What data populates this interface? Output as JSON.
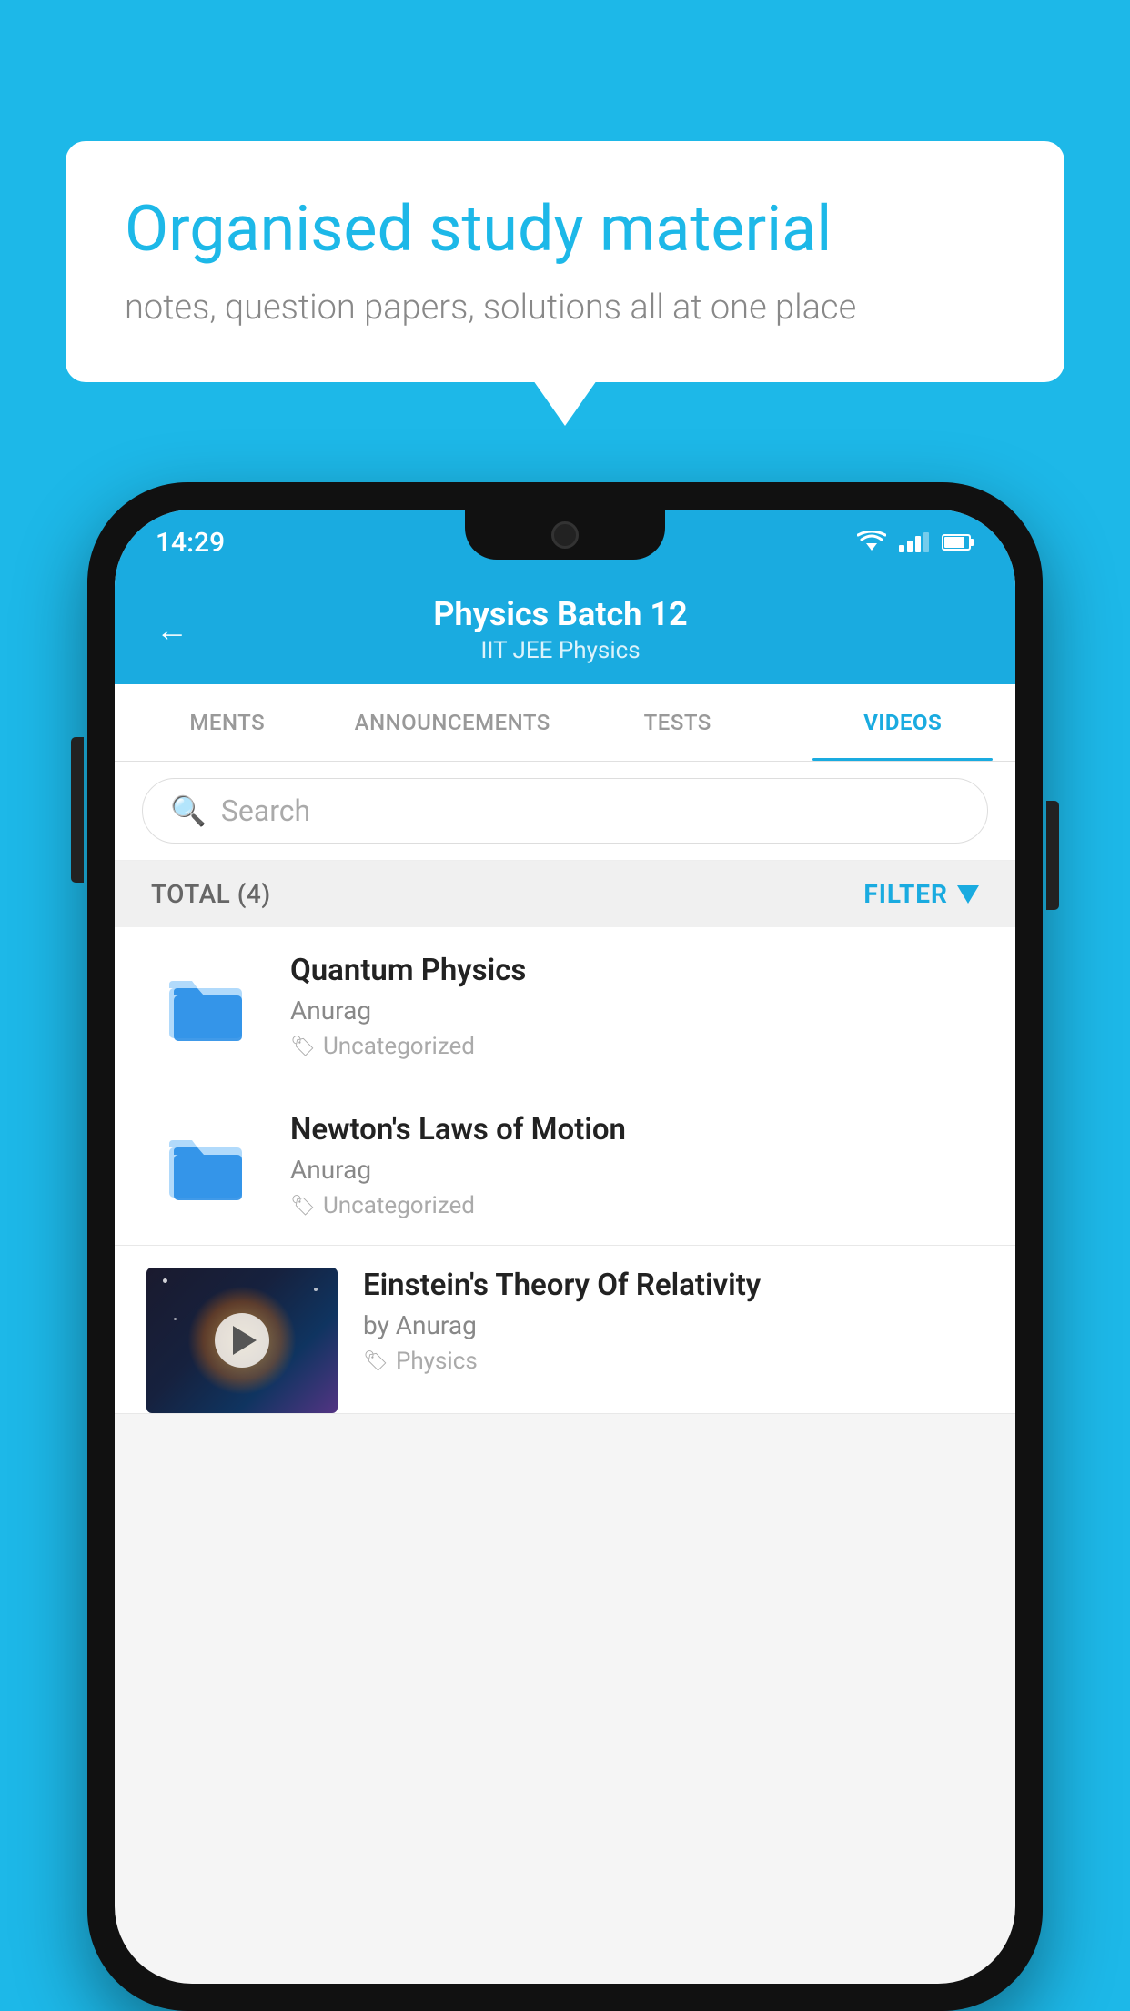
{
  "background": {
    "color": "#1DB8E8"
  },
  "speech_bubble": {
    "title": "Organised study material",
    "subtitle": "notes, question papers, solutions all at one place"
  },
  "phone": {
    "status_bar": {
      "time": "14:29"
    },
    "header": {
      "back_label": "←",
      "title": "Physics Batch 12",
      "subtitle": "IIT JEE   Physics"
    },
    "tabs": [
      {
        "label": "MENTS",
        "active": false
      },
      {
        "label": "ANNOUNCEMENTS",
        "active": false
      },
      {
        "label": "TESTS",
        "active": false
      },
      {
        "label": "VIDEOS",
        "active": true
      }
    ],
    "search": {
      "placeholder": "Search"
    },
    "filter_bar": {
      "total_label": "TOTAL (4)",
      "filter_label": "FILTER"
    },
    "video_items": [
      {
        "id": 1,
        "title": "Quantum Physics",
        "author": "Anurag",
        "tag": "Uncategorized",
        "has_thumbnail": false
      },
      {
        "id": 2,
        "title": "Newton's Laws of Motion",
        "author": "Anurag",
        "tag": "Uncategorized",
        "has_thumbnail": false
      },
      {
        "id": 3,
        "title": "Einstein's Theory Of Relativity",
        "author": "by Anurag",
        "tag": "Physics",
        "has_thumbnail": true
      }
    ]
  }
}
